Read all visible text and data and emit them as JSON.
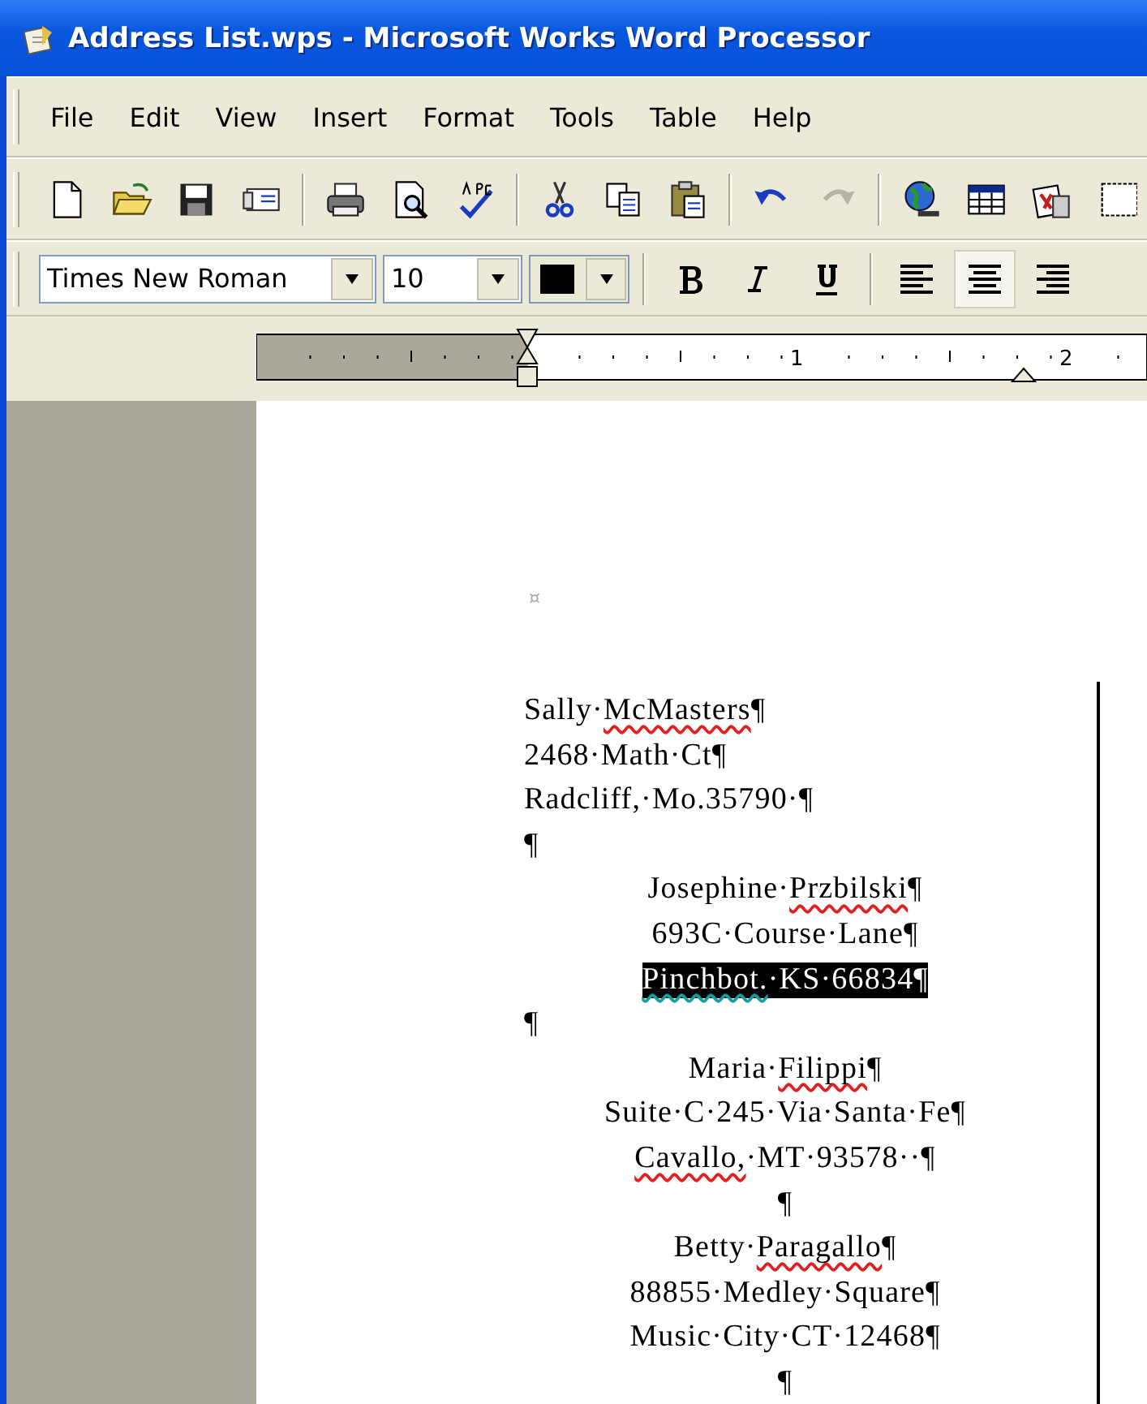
{
  "window": {
    "title": "Address List.wps - Microsoft Works Word Processor"
  },
  "menu": [
    "File",
    "Edit",
    "View",
    "Insert",
    "Format",
    "Tools",
    "Table",
    "Help"
  ],
  "toolbar_groups": [
    {
      "buttons": [
        {
          "kind": "new",
          "disabled": false
        },
        {
          "kind": "open",
          "disabled": false
        },
        {
          "kind": "save",
          "disabled": false
        },
        {
          "kind": "mail",
          "disabled": false
        }
      ]
    },
    {
      "buttons": [
        {
          "kind": "print",
          "disabled": false
        },
        {
          "kind": "preview",
          "disabled": false
        },
        {
          "kind": "spell",
          "disabled": false
        }
      ]
    },
    {
      "buttons": [
        {
          "kind": "cut",
          "disabled": false
        },
        {
          "kind": "copy",
          "disabled": false
        },
        {
          "kind": "paste",
          "disabled": false
        }
      ]
    },
    {
      "buttons": [
        {
          "kind": "undo",
          "disabled": false
        },
        {
          "kind": "redo",
          "disabled": true
        }
      ]
    },
    {
      "buttons": [
        {
          "kind": "globe",
          "disabled": false
        },
        {
          "kind": "table",
          "disabled": false
        },
        {
          "kind": "clipart",
          "disabled": false
        },
        {
          "kind": "partial",
          "disabled": false
        }
      ]
    }
  ],
  "format_bar": {
    "font": "Times New Roman",
    "size": "10",
    "alignment": [
      {
        "kind": "left",
        "selected": false
      },
      {
        "kind": "center",
        "selected": true
      },
      {
        "kind": "right",
        "selected": false
      }
    ],
    "styles": [
      {
        "kind": "bold",
        "selected": false
      },
      {
        "kind": "italic",
        "selected": false
      },
      {
        "kind": "underline",
        "selected": false
      }
    ]
  },
  "ruler": {
    "labels": [
      "1",
      "2"
    ]
  },
  "document": {
    "marker": "¤",
    "lines": [
      {
        "kind": "left",
        "selected": false,
        "runs": [
          {
            "kind": "plain",
            "text": "Sally·"
          },
          {
            "kind": "spelling",
            "text": "McMasters"
          },
          {
            "kind": "plain",
            "text": "¶"
          }
        ]
      },
      {
        "kind": "left",
        "selected": false,
        "runs": [
          {
            "kind": "plain",
            "text": "2468·Math·Ct¶"
          }
        ]
      },
      {
        "kind": "left",
        "selected": false,
        "runs": [
          {
            "kind": "plain",
            "text": "Radcliff,·Mo.35790·¶"
          }
        ]
      },
      {
        "kind": "left",
        "selected": false,
        "runs": [
          {
            "kind": "plain",
            "text": "¶"
          }
        ]
      },
      {
        "kind": "center",
        "selected": false,
        "runs": [
          {
            "kind": "plain",
            "text": "Josephine·"
          },
          {
            "kind": "spelling",
            "text": "Przbilski"
          },
          {
            "kind": "plain",
            "text": "¶"
          }
        ]
      },
      {
        "kind": "center",
        "selected": false,
        "runs": [
          {
            "kind": "plain",
            "text": "693C·Course·Lane¶"
          }
        ]
      },
      {
        "kind": "center",
        "selected": true,
        "runs": [
          {
            "kind": "grammar",
            "text": "Pinchbot."
          },
          {
            "kind": "plain",
            "text": "·KS·66834¶"
          }
        ]
      },
      {
        "kind": "left",
        "selected": false,
        "runs": [
          {
            "kind": "plain",
            "text": "¶"
          }
        ]
      },
      {
        "kind": "center",
        "selected": false,
        "runs": [
          {
            "kind": "plain",
            "text": "Maria·"
          },
          {
            "kind": "spelling",
            "text": "Filippi"
          },
          {
            "kind": "plain",
            "text": "¶"
          }
        ]
      },
      {
        "kind": "center",
        "selected": false,
        "runs": [
          {
            "kind": "plain",
            "text": "Suite·C·245·Via·Santa·Fe¶"
          }
        ]
      },
      {
        "kind": "center",
        "selected": false,
        "runs": [
          {
            "kind": "spelling",
            "text": "Cavallo,"
          },
          {
            "kind": "plain",
            "text": "·MT·93578··¶"
          }
        ]
      },
      {
        "kind": "center",
        "selected": false,
        "runs": [
          {
            "kind": "plain",
            "text": "¶"
          }
        ]
      },
      {
        "kind": "center",
        "selected": false,
        "runs": [
          {
            "kind": "plain",
            "text": "Betty·"
          },
          {
            "kind": "spelling",
            "text": "Paragallo"
          },
          {
            "kind": "plain",
            "text": "¶"
          }
        ]
      },
      {
        "kind": "center",
        "selected": false,
        "runs": [
          {
            "kind": "plain",
            "text": "88855·Medley·Square¶"
          }
        ]
      },
      {
        "kind": "center",
        "selected": false,
        "runs": [
          {
            "kind": "plain",
            "text": "Music·City·CT·12468¶"
          }
        ]
      },
      {
        "kind": "center",
        "selected": false,
        "runs": [
          {
            "kind": "plain",
            "text": "¶"
          }
        ]
      }
    ]
  }
}
